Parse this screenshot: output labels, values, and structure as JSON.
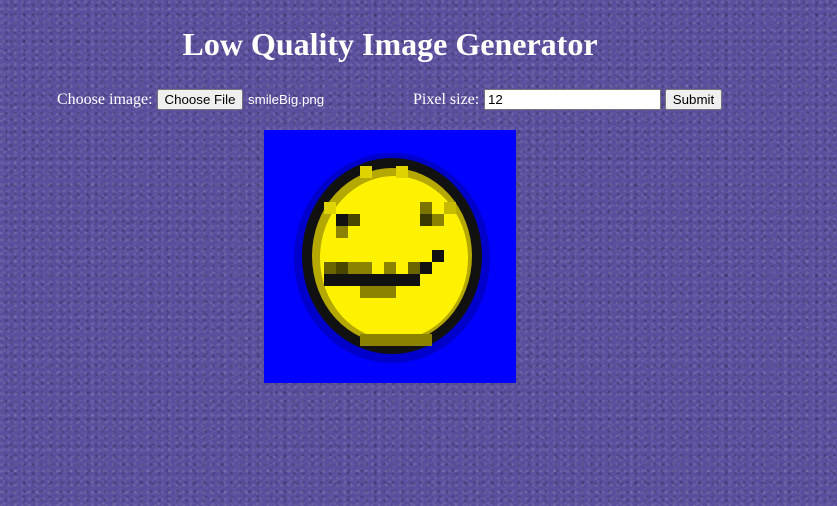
{
  "page": {
    "title": "Low Quality Image Generator"
  },
  "form": {
    "choose_image_label": "Choose image:",
    "choose_file_button": "Choose File",
    "file_name": "smileBig.png",
    "pixel_size_label": "Pixel size:",
    "pixel_size_value": "12",
    "submit_button": "Submit"
  },
  "colors": {
    "background": "#5a4f9e",
    "image_background": "#0000ff",
    "smiley_face": "#fff200",
    "smiley_outline": "#111111"
  },
  "output_image": {
    "description_icon": "pixelated-smiley-image",
    "pixel_size": 12
  }
}
